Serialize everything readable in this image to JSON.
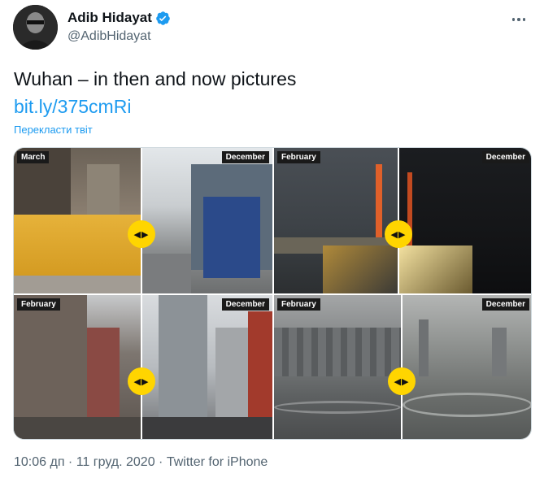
{
  "author": {
    "display_name": "Adib Hidayat",
    "handle": "@AdibHidayat",
    "verified": true
  },
  "icons": {
    "verified": "verified-badge-icon",
    "more": "more-horizontal-icon",
    "slider": "left-right-arrows-icon"
  },
  "tweet": {
    "text": "Wuhan – in then and now pictures",
    "link": "bit.ly/375cmRi",
    "translate": "Перекласти твіт",
    "meta": "10:06 дп · 11 груд. 2020 · Twitter for iPhone"
  },
  "media": [
    {
      "left_label": "March",
      "right_label": "December",
      "knob": "◀▶"
    },
    {
      "left_label": "February",
      "right_label": "December",
      "knob": "◀▶"
    },
    {
      "left_label": "February",
      "right_label": "December",
      "knob": "◀▶"
    },
    {
      "left_label": "February",
      "right_label": "December",
      "knob": "◀▶"
    }
  ],
  "colors": {
    "accent": "#1d9bf0",
    "knob": "#ffd500",
    "text": "#0f1419",
    "secondary": "#536471"
  }
}
